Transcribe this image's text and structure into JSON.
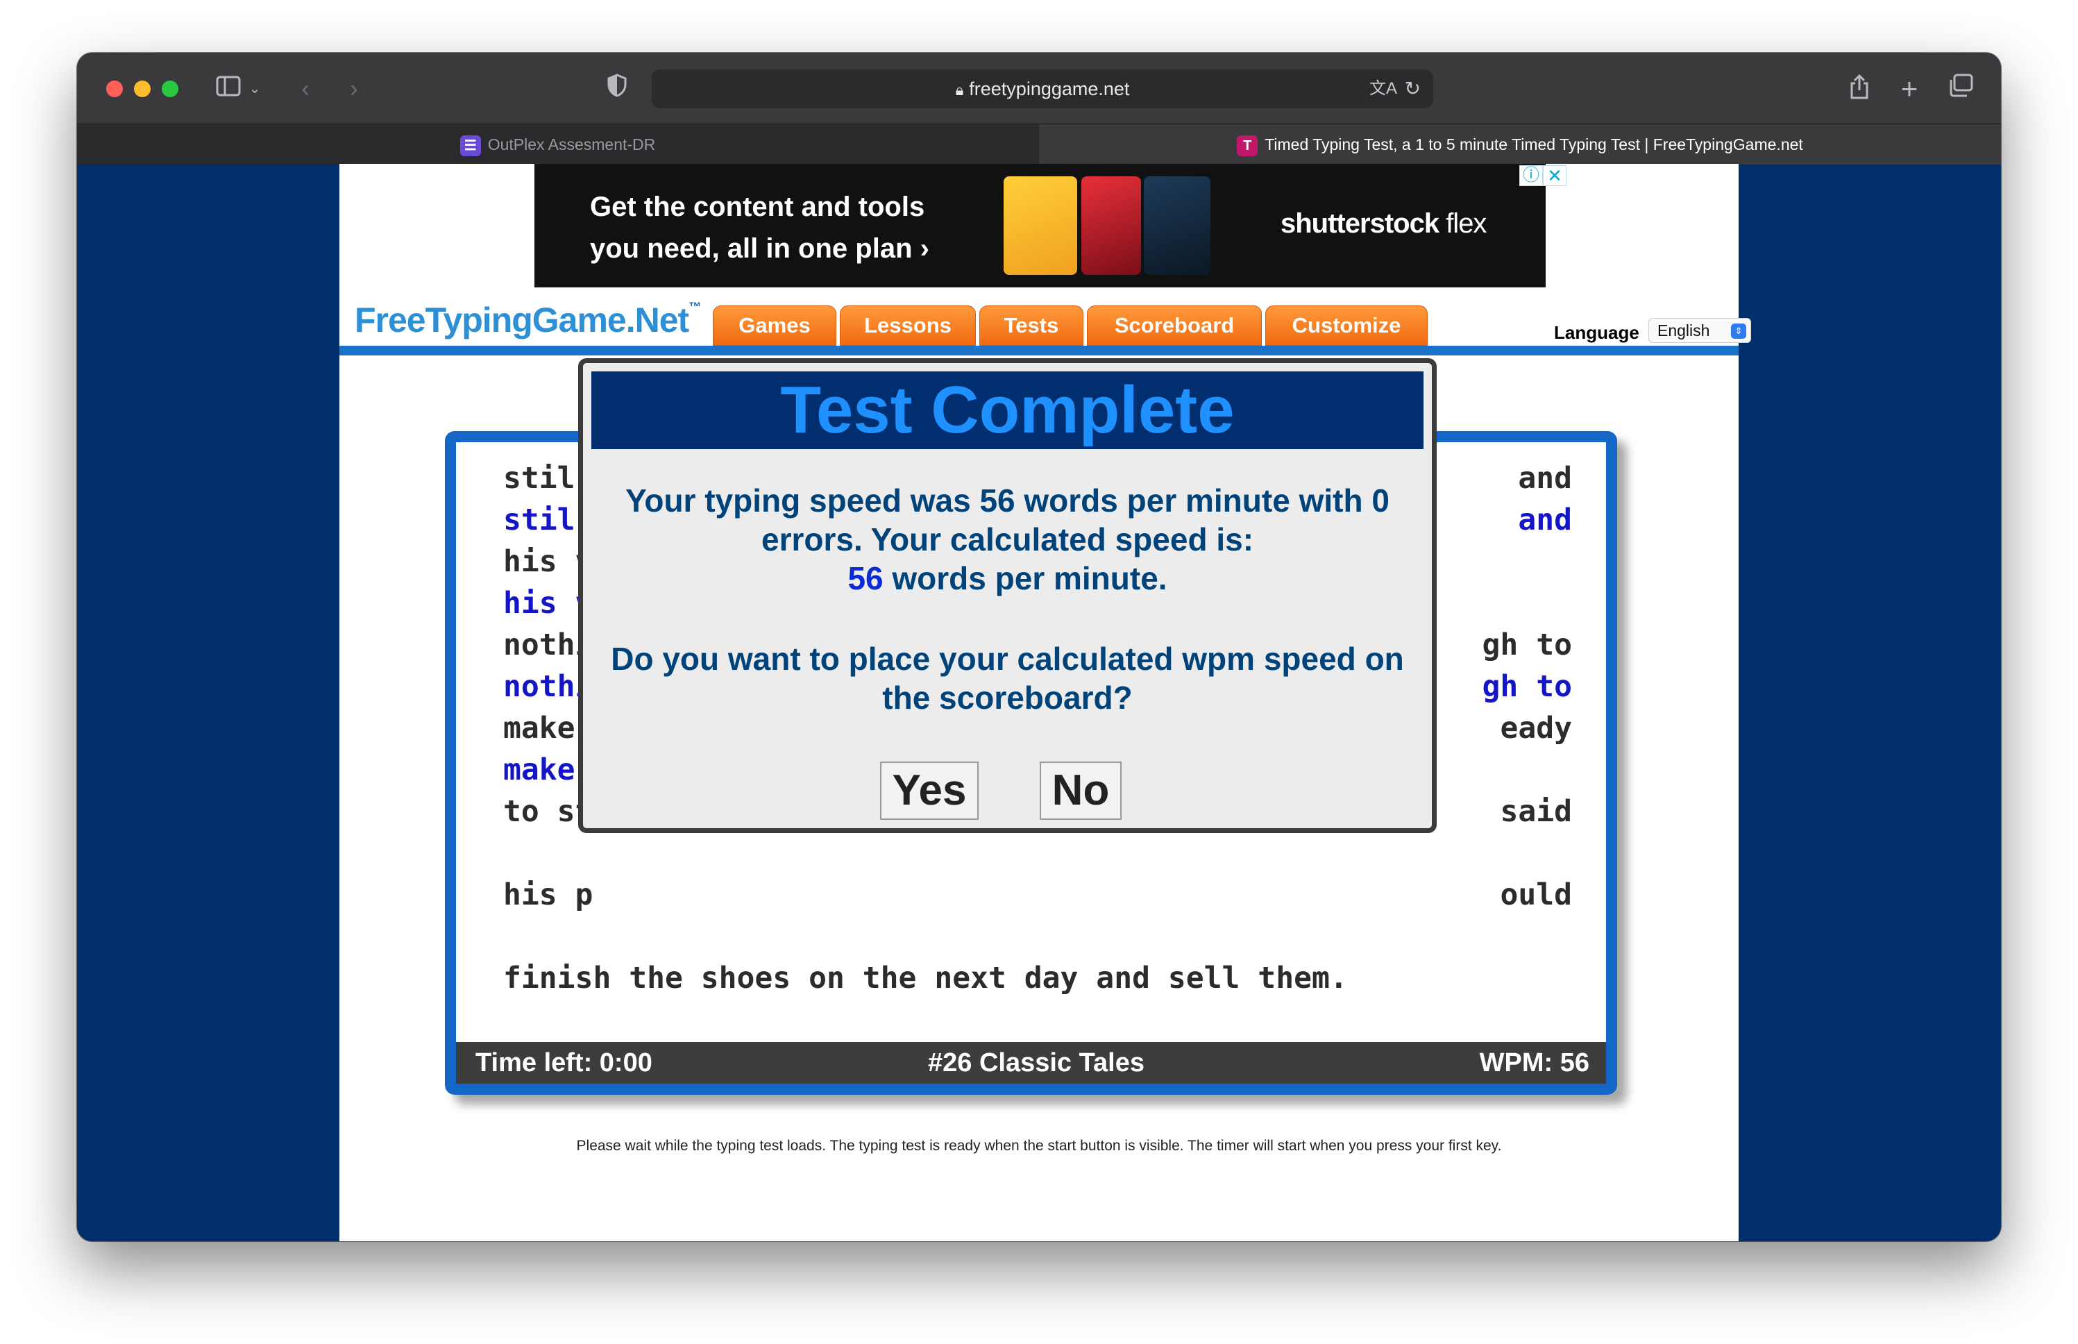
{
  "browser": {
    "url": "freetypinggame.net",
    "tabs": [
      {
        "title": "OutPlex Assesment-DR",
        "active": false
      },
      {
        "title": "Timed Typing Test, a 1 to 5 minute Timed Typing Test | FreeTypingGame.net",
        "active": true
      }
    ]
  },
  "ad": {
    "line1": "Get the content and tools",
    "line2": "you need, all in one plan ›",
    "brand": "shutterstock",
    "brand_suffix": "flex"
  },
  "site": {
    "logo": "FreeTypingGame.Net",
    "logo_mark": "™",
    "nav": [
      "Games",
      "Lessons",
      "Tests",
      "Scoreboard",
      "Customize"
    ],
    "language_label": "Language",
    "language_value": "English"
  },
  "typing": {
    "lines": [
      {
        "left": "stil",
        "right": "and",
        "typed": false
      },
      {
        "left": "stil",
        "right": "and",
        "typed": true
      },
      {
        "left": "his v",
        "right": "",
        "typed": false
      },
      {
        "left": "his v",
        "right": "",
        "typed": true
      },
      {
        "left": "nothi",
        "right": "gh to",
        "typed": false
      },
      {
        "left": "nothi",
        "right": "gh to",
        "typed": true
      },
      {
        "left": "make",
        "right": "eady",
        "typed": false
      },
      {
        "left": "make",
        "right": "",
        "typed": true
      },
      {
        "left": "to st",
        "right": "said",
        "typed": false
      },
      {
        "left": "his p",
        "right": "ould",
        "typed": false
      },
      {
        "left": "finish the shoes on the next day and sell them.",
        "right": "",
        "typed": false
      }
    ]
  },
  "status": {
    "time_left": "Time left: 0:00",
    "lesson": "#26 Classic Tales",
    "wpm": "WPM: 56"
  },
  "dialog": {
    "title": "Test Complete",
    "line1": "Your typing speed was 56 words per minute with 0",
    "line2": "errors. Your calculated speed is:",
    "speed": "56",
    "speed_suffix": " words per minute.",
    "question1": "Do you want to place your calculated wpm speed on",
    "question2": "the scoreboard?",
    "yes": "Yes",
    "no": "No"
  },
  "footer_note": "Please wait while the typing test loads. The typing test is ready when the start button is visible. The timer will start when you press your first key.",
  "colors": {
    "page_bg": "#002f6c",
    "nav_orange": "#f58220",
    "accent_blue": "#1466c7",
    "dialog_title_bg": "#002e6e",
    "dialog_title_text": "#1e90ff",
    "typed_text": "#1515c8"
  }
}
